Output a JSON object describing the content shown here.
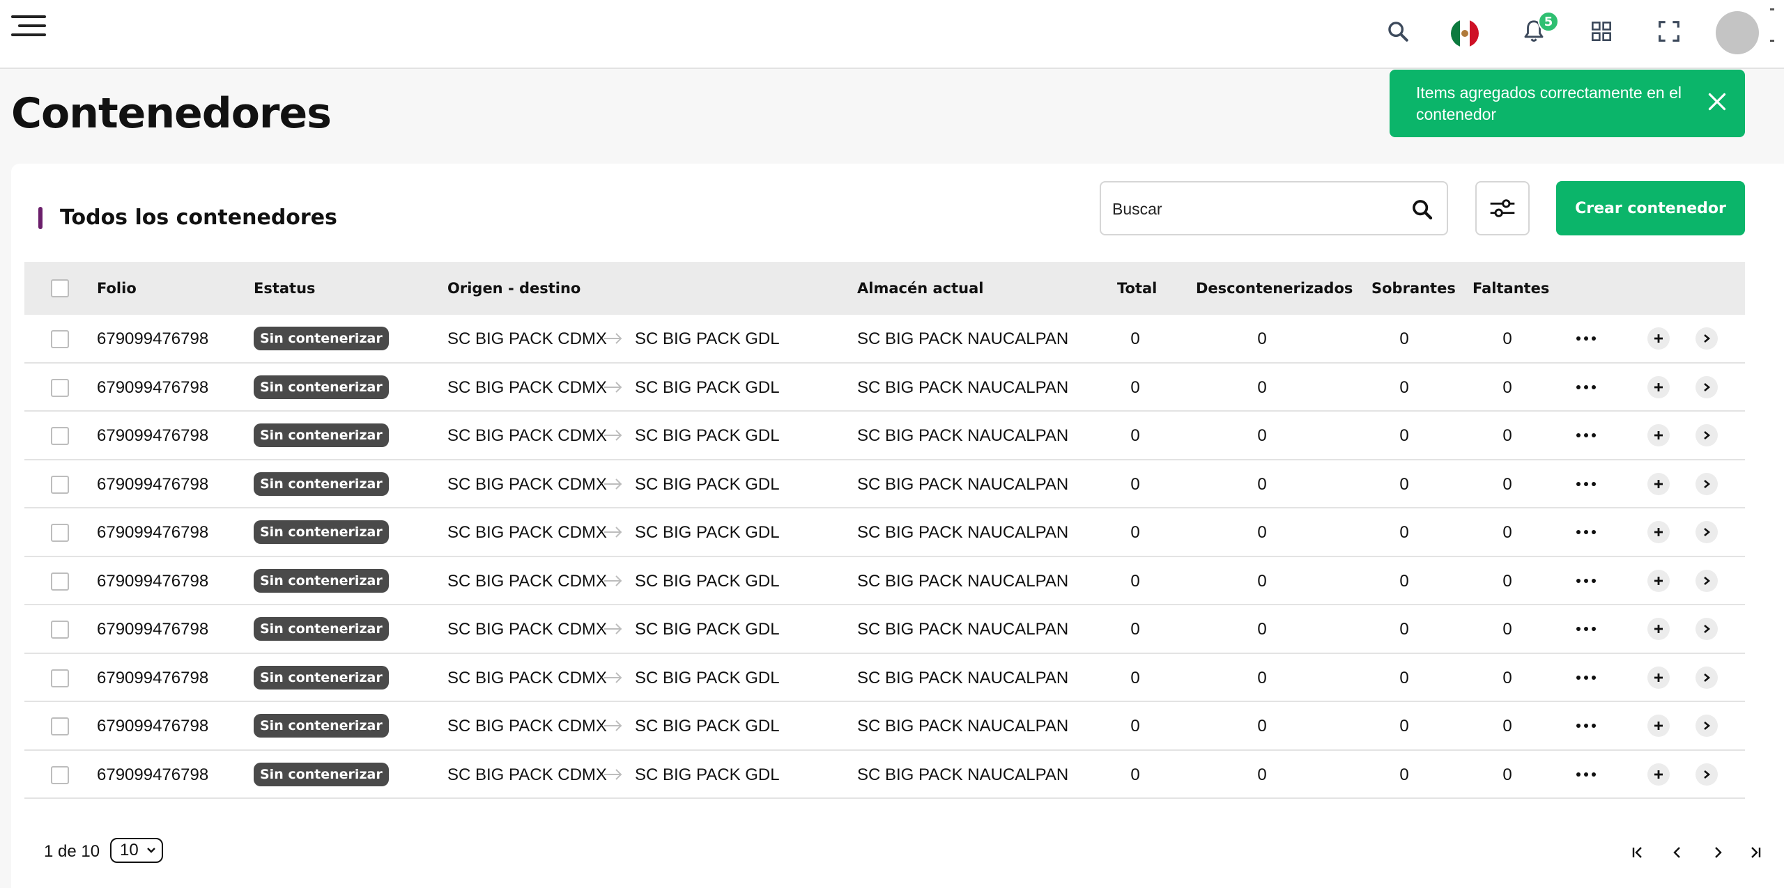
{
  "header": {
    "notification_count": "5",
    "icons": [
      "menu-icon",
      "search-icon",
      "mexico-flag-icon",
      "bell-icon",
      "apps-grid-icon",
      "fullscreen-icon",
      "avatar"
    ]
  },
  "page": {
    "title": "Contenedores"
  },
  "toast": {
    "message": "Items agregados correctamente en el contenedor",
    "color": "#0bb56a"
  },
  "card": {
    "title": "Todos los contenedores",
    "search_placeholder": "Buscar",
    "create_button": "Crear contenedor"
  },
  "table": {
    "columns": [
      "Folio",
      "Estatus",
      "Origen - destino",
      "Almacén actual",
      "Total",
      "Descontenerizados",
      "Sobrantes",
      "Faltantes"
    ],
    "rows": [
      {
        "folio": "679099476798",
        "status": "Sin contenerizar",
        "origin": "SC BIG PACK CDMX",
        "destination": "SC BIG PACK GDL",
        "warehouse": "SC BIG PACK NAUCALPAN",
        "total": "0",
        "decontainerized": "0",
        "surplus": "0",
        "missing": "0"
      },
      {
        "folio": "679099476798",
        "status": "Sin contenerizar",
        "origin": "SC BIG PACK CDMX",
        "destination": "SC BIG PACK GDL",
        "warehouse": "SC BIG PACK NAUCALPAN",
        "total": "0",
        "decontainerized": "0",
        "surplus": "0",
        "missing": "0"
      },
      {
        "folio": "679099476798",
        "status": "Sin contenerizar",
        "origin": "SC BIG PACK CDMX",
        "destination": "SC BIG PACK GDL",
        "warehouse": "SC BIG PACK NAUCALPAN",
        "total": "0",
        "decontainerized": "0",
        "surplus": "0",
        "missing": "0"
      },
      {
        "folio": "679099476798",
        "status": "Sin contenerizar",
        "origin": "SC BIG PACK CDMX",
        "destination": "SC BIG PACK GDL",
        "warehouse": "SC BIG PACK NAUCALPAN",
        "total": "0",
        "decontainerized": "0",
        "surplus": "0",
        "missing": "0"
      },
      {
        "folio": "679099476798",
        "status": "Sin contenerizar",
        "origin": "SC BIG PACK CDMX",
        "destination": "SC BIG PACK GDL",
        "warehouse": "SC BIG PACK NAUCALPAN",
        "total": "0",
        "decontainerized": "0",
        "surplus": "0",
        "missing": "0"
      },
      {
        "folio": "679099476798",
        "status": "Sin contenerizar",
        "origin": "SC BIG PACK CDMX",
        "destination": "SC BIG PACK GDL",
        "warehouse": "SC BIG PACK NAUCALPAN",
        "total": "0",
        "decontainerized": "0",
        "surplus": "0",
        "missing": "0"
      },
      {
        "folio": "679099476798",
        "status": "Sin contenerizar",
        "origin": "SC BIG PACK CDMX",
        "destination": "SC BIG PACK GDL",
        "warehouse": "SC BIG PACK NAUCALPAN",
        "total": "0",
        "decontainerized": "0",
        "surplus": "0",
        "missing": "0"
      },
      {
        "folio": "679099476798",
        "status": "Sin contenerizar",
        "origin": "SC BIG PACK CDMX",
        "destination": "SC BIG PACK GDL",
        "warehouse": "SC BIG PACK NAUCALPAN",
        "total": "0",
        "decontainerized": "0",
        "surplus": "0",
        "missing": "0"
      },
      {
        "folio": "679099476798",
        "status": "Sin contenerizar",
        "origin": "SC BIG PACK CDMX",
        "destination": "SC BIG PACK GDL",
        "warehouse": "SC BIG PACK NAUCALPAN",
        "total": "0",
        "decontainerized": "0",
        "surplus": "0",
        "missing": "0"
      },
      {
        "folio": "679099476798",
        "status": "Sin contenerizar",
        "origin": "SC BIG PACK CDMX",
        "destination": "SC BIG PACK GDL",
        "warehouse": "SC BIG PACK NAUCALPAN",
        "total": "0",
        "decontainerized": "0",
        "surplus": "0",
        "missing": "0"
      }
    ]
  },
  "pagination": {
    "label": "1 de 10",
    "page_size": "10"
  }
}
